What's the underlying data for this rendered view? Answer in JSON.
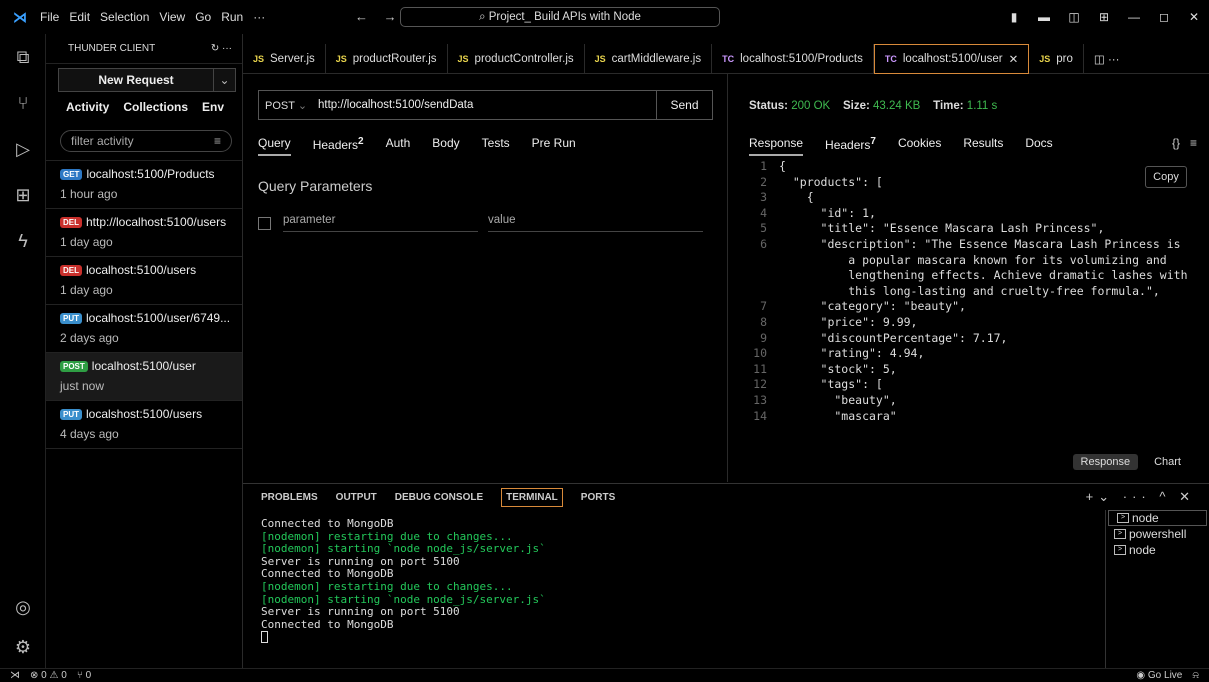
{
  "window": {
    "menu": [
      "File",
      "Edit",
      "Selection",
      "View",
      "Go",
      "Run",
      "···"
    ],
    "command_center": "Project_ Build APIs with Node"
  },
  "sidebar": {
    "title": "THUNDER CLIENT",
    "new_request": "New Request",
    "tabs": [
      "Activity",
      "Collections",
      "Env"
    ],
    "filter_placeholder": "filter activity",
    "items": [
      {
        "method": "GET",
        "url": "localhost:5100/Products",
        "time": "1 hour ago"
      },
      {
        "method": "DEL",
        "url": "http://localhost:5100/users",
        "time": "1 day ago"
      },
      {
        "method": "DEL",
        "url": "localhost:5100/users",
        "time": "1 day ago"
      },
      {
        "method": "PUT",
        "url": "localhost:5100/user/6749...",
        "time": "2 days ago"
      },
      {
        "method": "POST",
        "url": "localhost:5100/user",
        "time": "just now"
      },
      {
        "method": "PUT",
        "url": "localshost:5100/users",
        "time": "4 days ago"
      }
    ]
  },
  "editor_tabs": [
    {
      "type": "JS",
      "label": "Server.js"
    },
    {
      "type": "JS",
      "label": "productRouter.js"
    },
    {
      "type": "JS",
      "label": "productController.js"
    },
    {
      "type": "JS",
      "label": "cartMiddleware.js"
    },
    {
      "type": "TC",
      "label": "localhost:5100/Products"
    },
    {
      "type": "TC",
      "label": "localhost:5100/user"
    },
    {
      "type": "JS",
      "label": "pro"
    }
  ],
  "request": {
    "method": "POST",
    "url": "http://localhost:5100/sendData",
    "send": "Send",
    "tabs": [
      "Query",
      "Headers",
      "Auth",
      "Body",
      "Tests",
      "Pre Run"
    ],
    "headers_count": "2",
    "query_title": "Query Parameters",
    "param_placeholder": "parameter",
    "value_placeholder": "value"
  },
  "response": {
    "status_label": "Status:",
    "status": "200 OK",
    "size_label": "Size:",
    "size": "43.24 KB",
    "time_label": "Time:",
    "time": "1.11 s",
    "tabs": [
      "Response",
      "Headers",
      "Cookies",
      "Results",
      "Docs"
    ],
    "headers_count": "7",
    "braces": "{}",
    "copy": "Copy",
    "foot_response": "Response",
    "foot_chart": "Chart",
    "lines": [
      {
        "n": "1",
        "t": "{"
      },
      {
        "n": "2",
        "t": "  \"products\": ["
      },
      {
        "n": "3",
        "t": "    {"
      },
      {
        "n": "4",
        "t": "      \"id\": 1,"
      },
      {
        "n": "5",
        "t": "      \"title\": \"Essence Mascara Lash Princess\","
      },
      {
        "n": "6",
        "t": "      \"description\": \"The Essence Mascara Lash Princess is"
      },
      {
        "n": "",
        "t": "          a popular mascara known for its volumizing and"
      },
      {
        "n": "",
        "t": "          lengthening effects. Achieve dramatic lashes with"
      },
      {
        "n": "",
        "t": "          this long-lasting and cruelty-free formula.\","
      },
      {
        "n": "7",
        "t": "      \"category\": \"beauty\","
      },
      {
        "n": "8",
        "t": "      \"price\": 9.99,"
      },
      {
        "n": "9",
        "t": "      \"discountPercentage\": 7.17,"
      },
      {
        "n": "10",
        "t": "      \"rating\": 4.94,"
      },
      {
        "n": "11",
        "t": "      \"stock\": 5,"
      },
      {
        "n": "12",
        "t": "      \"tags\": ["
      },
      {
        "n": "13",
        "t": "        \"beauty\","
      },
      {
        "n": "14",
        "t": "        \"mascara\""
      }
    ]
  },
  "panel": {
    "tabs": [
      "PROBLEMS",
      "OUTPUT",
      "DEBUG CONSOLE",
      "TERMINAL",
      "PORTS"
    ],
    "terminal": [
      {
        "c": "w",
        "t": "Connected to MongoDB"
      },
      {
        "c": "g",
        "t": "[nodemon] restarting due to changes..."
      },
      {
        "c": "g",
        "t": "[nodemon] starting `node node_js/server.js`"
      },
      {
        "c": "w",
        "t": "Server is running on port 5100"
      },
      {
        "c": "w",
        "t": "Connected to MongoDB"
      },
      {
        "c": "g",
        "t": "[nodemon] restarting due to changes..."
      },
      {
        "c": "g",
        "t": "[nodemon] starting `node node_js/server.js`"
      },
      {
        "c": "w",
        "t": "Server is running on port 5100"
      },
      {
        "c": "w",
        "t": "Connected to MongoDB"
      }
    ],
    "terminals": [
      "node",
      "powershell",
      "node"
    ]
  },
  "statusbar": {
    "errors": "⊗ 0 ⚠ 0",
    "ports": "⑂ 0",
    "go_live": "Go Live"
  }
}
